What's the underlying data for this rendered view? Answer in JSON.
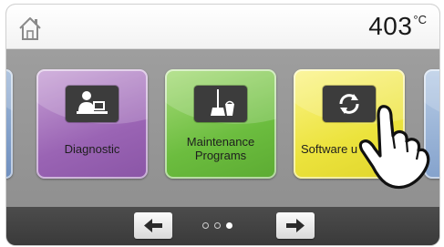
{
  "header": {
    "temperature": "403",
    "temperature_unit": "°C",
    "home_icon": "home-icon"
  },
  "tiles": [
    {
      "label": "Diagnostic",
      "icon": "person-desk-icon",
      "color": "#9a64b4"
    },
    {
      "label": "Maintenance\nPrograms",
      "icon": "broom-bucket-icon",
      "color": "#6cbd3f"
    },
    {
      "label": "Software u",
      "icon": "refresh-arrows-icon",
      "color": "#ece33d"
    }
  ],
  "pagination": {
    "prev_icon": "arrow-left-icon",
    "next_icon": "arrow-right-icon",
    "pages": 3,
    "current_page": 3
  },
  "colors": {
    "header_bg": "#f6f6f6",
    "content_bg": "#969696",
    "footer_bg": "#404040"
  }
}
